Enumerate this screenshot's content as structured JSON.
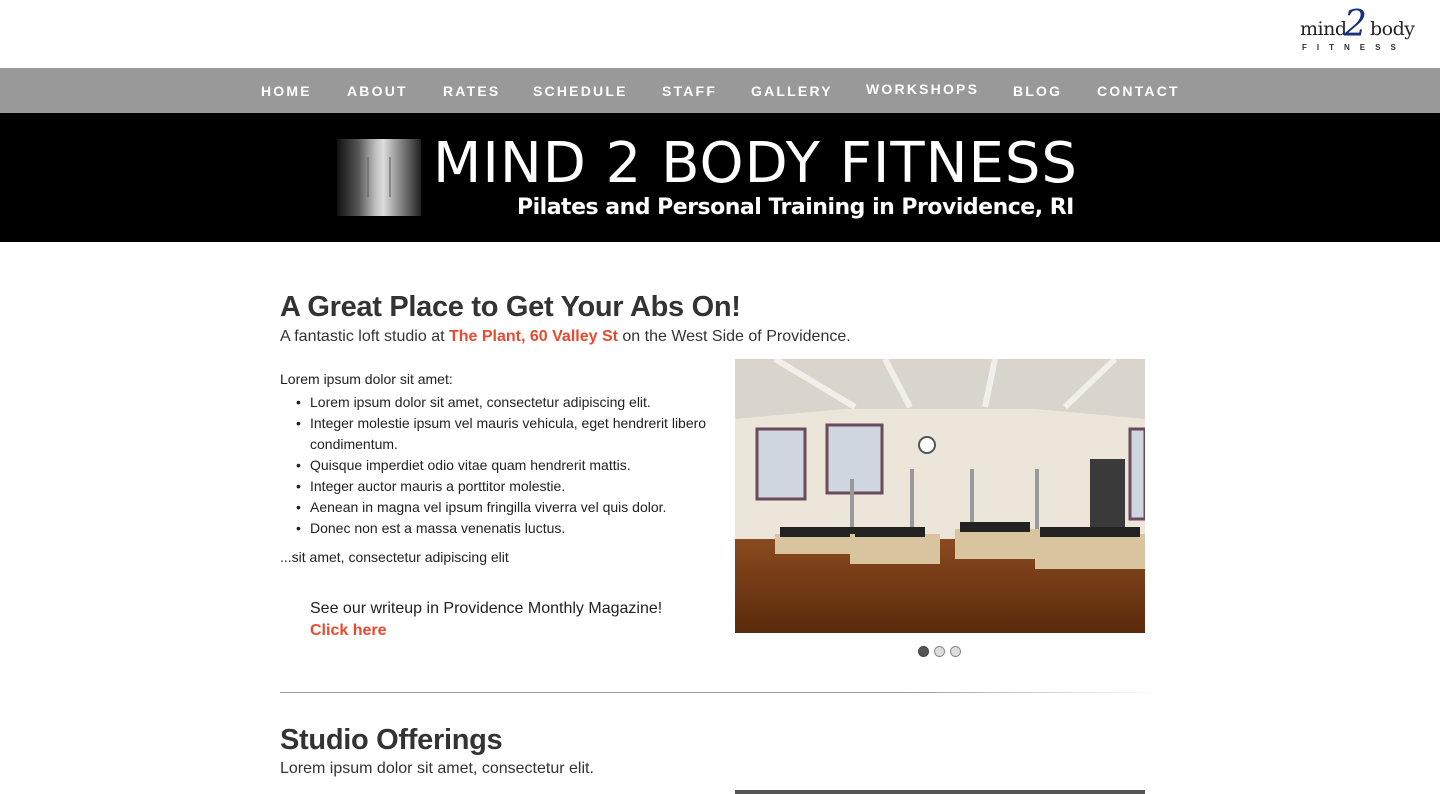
{
  "logo": {
    "word1": "mind",
    "two": "2",
    "word2": "body",
    "sub": "FITNESS"
  },
  "nav": {
    "items": [
      "HOME",
      "ABOUT",
      "RATES",
      "SCHEDULE",
      "STAFF",
      "GALLERY",
      "WORKSHOPS",
      "BLOG",
      "CONTACT"
    ]
  },
  "banner": {
    "title": "MIND 2 BODY FITNESS",
    "subtitle": "Pilates and Personal Training in Providence, RI"
  },
  "section1": {
    "heading": "A Great Place to Get Your Abs On!",
    "intro_before": "A fantastic loft studio at ",
    "intro_link": "The Plant, 60 Valley St",
    "intro_after": " on the West Side of Providence.",
    "lead": "Lorem ipsum dolor sit amet:",
    "bullets": [
      "Lorem ipsum dolor sit amet, consectetur adipiscing elit.",
      "Integer molestie ipsum vel mauris vehicula, eget hendrerit libero condimentum.",
      "Quisque imperdiet odio vitae quam hendrerit mattis.",
      "Integer auctor mauris a porttitor molestie.",
      "Aenean in magna vel ipsum fringilla viverra vel quis dolor.",
      "Donec non est a massa venenatis luctus."
    ],
    "tail": "...sit amet, consectetur adipiscing elit",
    "writeup": "See our writeup in Providence Monthly Magazine!",
    "click": "Click here",
    "slider": {
      "count": 3,
      "active": 0
    }
  },
  "section2": {
    "heading": "Studio Offerings",
    "sub": "Lorem ipsum dolor sit amet, consectetur elit."
  },
  "colors": {
    "accent": "#e84a2e",
    "nav_bg": "#999999",
    "banner_bg": "#000000",
    "text": "#333333"
  }
}
